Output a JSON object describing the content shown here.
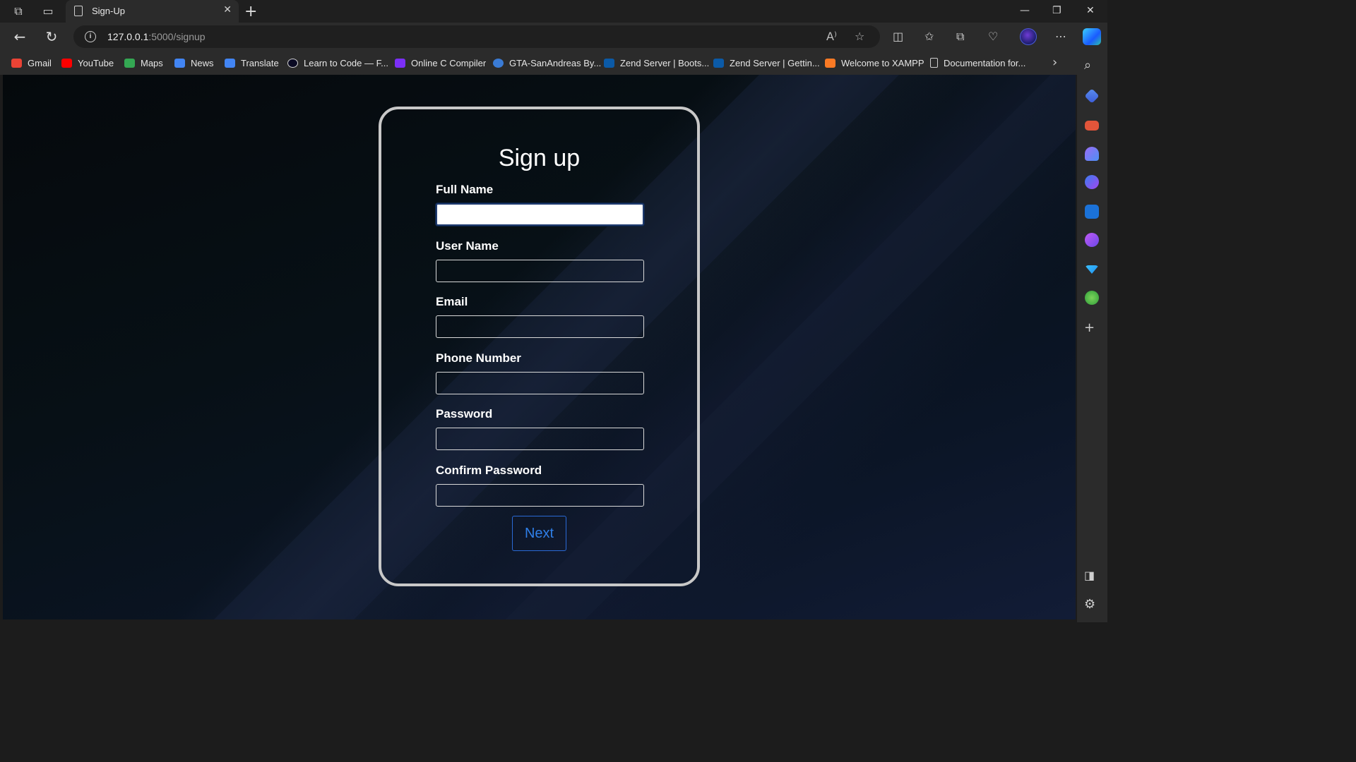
{
  "browser": {
    "tab_title": "Sign-Up",
    "address_host": "127.0.0.1",
    "address_path": ":5000/signup"
  },
  "bookmarks": [
    {
      "label": "Gmail",
      "color": "#ea4335"
    },
    {
      "label": "YouTube",
      "color": "#ff0000"
    },
    {
      "label": "Maps",
      "color": "#34a853"
    },
    {
      "label": "News",
      "color": "#4285f4"
    },
    {
      "label": "Translate",
      "color": "#4285f4"
    },
    {
      "label": "Learn to Code — F...",
      "color": "#0a0a23"
    },
    {
      "label": "Online C Compiler",
      "color": "#7b2ff7"
    },
    {
      "label": "GTA-SanAndreas By...",
      "color": "#3a7bd5"
    },
    {
      "label": "Zend Server | Boots...",
      "color": "#0b5aa7"
    },
    {
      "label": "Zend Server | Gettin...",
      "color": "#0b5aa7"
    },
    {
      "label": "Welcome to XAMPP",
      "color": "#fb7a24"
    },
    {
      "label": "Documentation for...",
      "color": "#2b2b2b"
    }
  ],
  "form": {
    "title": "Sign up",
    "fields": [
      {
        "label": "Full Name",
        "value": ""
      },
      {
        "label": "User Name",
        "value": ""
      },
      {
        "label": "Email",
        "value": ""
      },
      {
        "label": "Phone Number",
        "value": ""
      },
      {
        "label": "Password",
        "value": ""
      },
      {
        "label": "Confirm Password",
        "value": ""
      }
    ],
    "submit_label": "Next"
  },
  "colors": {
    "card_border": "#c8c8c8",
    "button_accent": "#2f7fe8"
  }
}
